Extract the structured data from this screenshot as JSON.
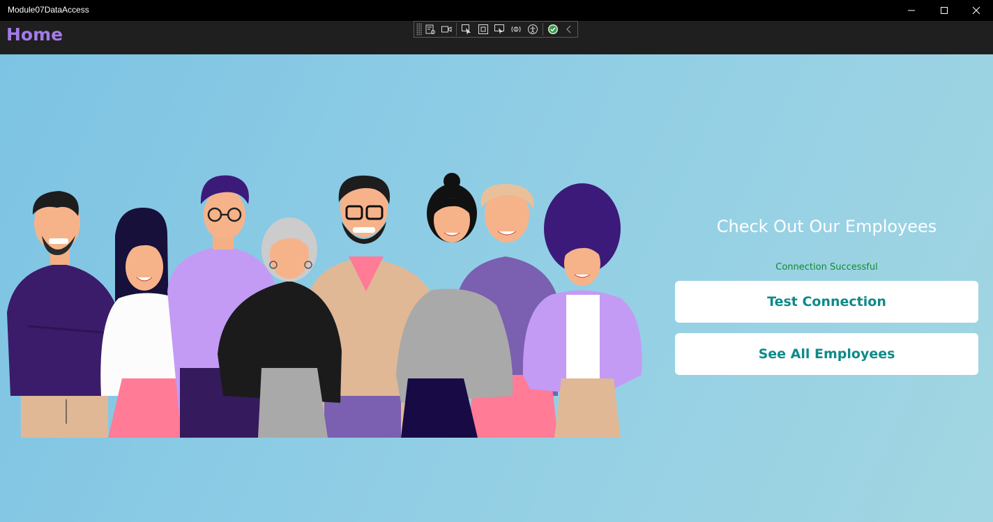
{
  "window": {
    "title": "Module07DataAccess",
    "controls": [
      "minimize-icon",
      "maximize-icon",
      "close-icon"
    ]
  },
  "nav": {
    "page_title": "Home"
  },
  "debug_toolbar": {
    "icons": [
      "live-visual-tree-icon",
      "video-icon",
      "select-element-icon",
      "display-layout-adorners-icon",
      "track-focus-icon",
      "binding-failures-icon",
      "accessibility-icon",
      "hot-reload-check-icon",
      "collapse-chevron-icon"
    ]
  },
  "main": {
    "heading": "Check Out Our Employees",
    "status": "Connection Successful",
    "buttons": {
      "test_connection": "Test Connection",
      "see_all_employees": "See All Employees"
    }
  },
  "colors": {
    "accent_title": "#a37be8",
    "button_text": "#0e8a8a",
    "status_success": "#138a2a",
    "background_start": "#7dc3e3",
    "background_end": "#a2d6e2"
  }
}
